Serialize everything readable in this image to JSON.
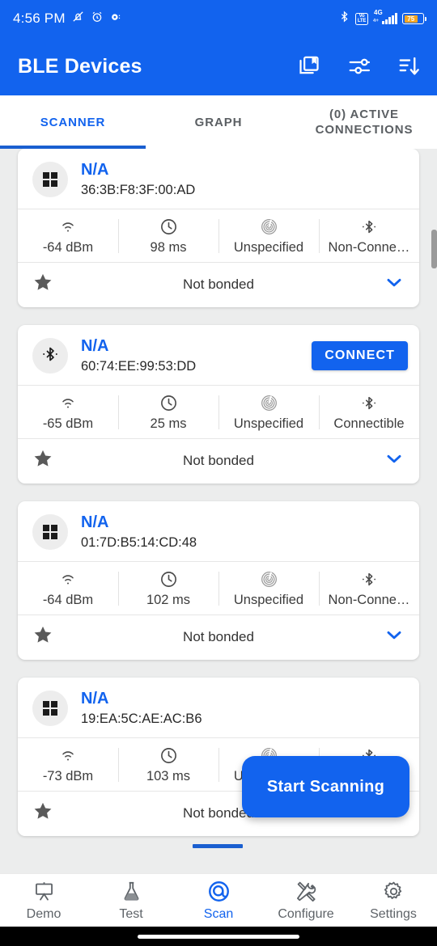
{
  "status_bar": {
    "time": "4:56 PM",
    "icons_left": [
      "silent-bell-icon",
      "alarm-clock-icon",
      "recording-dot-icon"
    ],
    "bluetooth_icon": "bluetooth-icon",
    "volte_label_top": "Vo",
    "volte_label_bottom": "LTE",
    "network_type": "4G",
    "network_sub": "4+",
    "battery_percent": "75",
    "battery_color": "#f5a623"
  },
  "app_bar": {
    "title": "BLE Devices",
    "background": "#1263ee",
    "actions": [
      {
        "name": "collections-bookmark-icon",
        "label": "Saved devices"
      },
      {
        "name": "tune-icon",
        "label": "Filter"
      },
      {
        "name": "sort-descending-icon",
        "label": "Sort"
      }
    ]
  },
  "tabs": {
    "active_index": 0,
    "items": [
      {
        "label": "SCANNER"
      },
      {
        "label": "GRAPH"
      },
      {
        "label": "(0) ACTIVE CONNECTIONS"
      }
    ],
    "accent": "#1263ee"
  },
  "devices": [
    {
      "icon": "grid-squares-icon",
      "name": "N/A",
      "mac": "36:3B:F8:3F:00:AD",
      "connect_label": null,
      "rssi": "-64 dBm",
      "interval": "98 ms",
      "appearance": "Unspecified",
      "connectivity": "Non-Conne…",
      "bond_state": "Not bonded"
    },
    {
      "icon": "bluetooth-icon",
      "name": "N/A",
      "mac": "60:74:EE:99:53:DD",
      "connect_label": "CONNECT",
      "rssi": "-65 dBm",
      "interval": "25 ms",
      "appearance": "Unspecified",
      "connectivity": "Connectible",
      "bond_state": "Not bonded"
    },
    {
      "icon": "grid-squares-icon",
      "name": "N/A",
      "mac": "01:7D:B5:14:CD:48",
      "connect_label": null,
      "rssi": "-64 dBm",
      "interval": "102 ms",
      "appearance": "Unspecified",
      "connectivity": "Non-Conne…",
      "bond_state": "Not bonded"
    },
    {
      "icon": "grid-squares-icon",
      "name": "N/A",
      "mac": "19:EA:5C:AE:AC:B6",
      "connect_label": null,
      "rssi": "-73 dBm",
      "interval": "103 ms",
      "appearance": "Unspecified",
      "connectivity": "Non-Conne…",
      "bond_state": "Not bonded"
    }
  ],
  "stat_icons": {
    "rssi": "signal-wifi-icon",
    "interval": "clock-icon",
    "appearance": "broadcast-rings-icon",
    "connectivity": "bluetooth-icon"
  },
  "fab": {
    "label": "Start Scanning",
    "color": "#1263ee"
  },
  "bottom_nav": {
    "active_index": 2,
    "items": [
      {
        "label": "Demo",
        "icon": "presentation-board-icon"
      },
      {
        "label": "Test",
        "icon": "flask-icon"
      },
      {
        "label": "Scan",
        "icon": "scan-target-icon"
      },
      {
        "label": "Configure",
        "icon": "tools-icon"
      },
      {
        "label": "Settings",
        "icon": "gear-icon"
      }
    ],
    "accent": "#1263ee"
  }
}
